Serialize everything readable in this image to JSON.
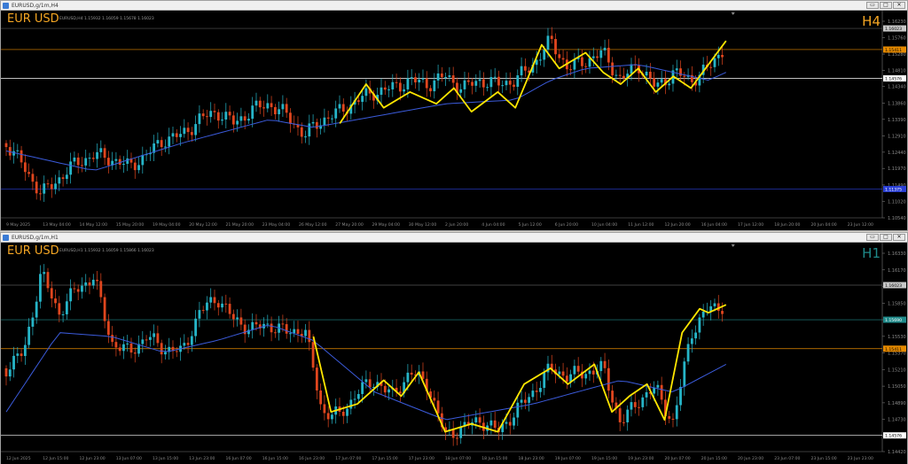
{
  "windows": [
    {
      "title": "EURUSD,g/1m,H4",
      "symbol": "EUR USD",
      "ohlc": "EURUSD,H4  1.15932 1.16059 1.15678 1.16023",
      "timeframe": "H4",
      "timeframe_color": "#f5a623",
      "price_ticks": [
        "1.16230",
        "1.15760",
        "1.15280",
        "1.14810",
        "1.14340",
        "1.13860",
        "1.13390",
        "1.12910",
        "1.12440",
        "1.11970",
        "1.11490",
        "1.11020",
        "1.10540"
      ],
      "markers": [
        {
          "label": "1.16023",
          "value": 1.16023,
          "bg": "#c8c8c8",
          "fg": "#000",
          "line": "#555"
        },
        {
          "label": "1.15411",
          "value": 1.15411,
          "bg": "#e68a00",
          "fg": "#000",
          "line": "#e68a00"
        },
        {
          "label": "1.14576",
          "value": 1.14576,
          "bg": "#ffffff",
          "fg": "#000",
          "line": "#ffffff"
        },
        {
          "label": "1.11375",
          "value": 1.11375,
          "bg": "#2a3fd6",
          "fg": "#fff",
          "line": "#2a3fd6"
        }
      ],
      "time_labels": [
        "9 May 2025",
        "13 May 04:00",
        "14 May 12:00",
        "15 May 20:00",
        "19 May 04:00",
        "20 May 12:00",
        "21 May 20:00",
        "23 May 04:00",
        "26 May 12:00",
        "27 May 20:00",
        "29 May 04:00",
        "30 May 12:00",
        "2 Jun 20:00",
        "4 Jun 04:00",
        "5 Jun 12:00",
        "6 Jun 20:00",
        "10 Jun 04:00",
        "11 Jun 12:00",
        "12 Jun 20:00",
        "16 Jun 04:00",
        "17 Jun 12:00",
        "18 Jun 20:00",
        "20 Jun 04:00",
        "23 Jun 12:00"
      ]
    },
    {
      "title": "EURUSD,g/1m,H1",
      "symbol": "EUR USD",
      "ohlc": "EURUSD,H1  1.15932 1.16059 1.15866 1.16023",
      "timeframe": "H1",
      "timeframe_color": "#1f8a8a",
      "price_ticks": [
        "1.16330",
        "1.16170",
        "1.16010",
        "1.15850",
        "1.15690",
        "1.15530",
        "1.15370",
        "1.15210",
        "1.15050",
        "1.14890",
        "1.14730",
        "1.14570",
        "1.14420"
      ],
      "markers": [
        {
          "label": "1.16023",
          "value": 1.16023,
          "bg": "#c8c8c8",
          "fg": "#000",
          "line": "#555"
        },
        {
          "label": "1.15690",
          "value": 1.1569,
          "bg": "#1f8a8a",
          "fg": "#fff",
          "line": "#1f8a8a"
        },
        {
          "label": "1.15411",
          "value": 1.15411,
          "bg": "#e68a00",
          "fg": "#000",
          "line": "#e68a00"
        },
        {
          "label": "1.14576",
          "value": 1.14576,
          "bg": "#ffffff",
          "fg": "#000",
          "line": "#ffffff"
        }
      ],
      "time_labels": [
        "12 Jun 2025",
        "12 Jun 15:00",
        "12 Jun 23:00",
        "13 Jun 07:00",
        "13 Jun 15:00",
        "13 Jun 23:00",
        "16 Jun 07:00",
        "16 Jun 15:00",
        "16 Jun 23:00",
        "17 Jun 07:00",
        "17 Jun 15:00",
        "17 Jun 23:00",
        "18 Jun 07:00",
        "18 Jun 15:00",
        "18 Jun 23:00",
        "19 Jun 07:00",
        "19 Jun 15:00",
        "19 Jun 23:00",
        "20 Jun 07:00",
        "20 Jun 15:00",
        "20 Jun 23:00",
        "23 Jun 07:00",
        "23 Jun 15:00",
        "23 Jun 23:00"
      ]
    }
  ],
  "colors": {
    "bull": "#26b5c8",
    "bear": "#e0461e",
    "ma": "#3b5bdb",
    "zigzag": "#ffe600",
    "grid": "#2a2a2a",
    "axis_text": "#8a8a8a"
  }
}
